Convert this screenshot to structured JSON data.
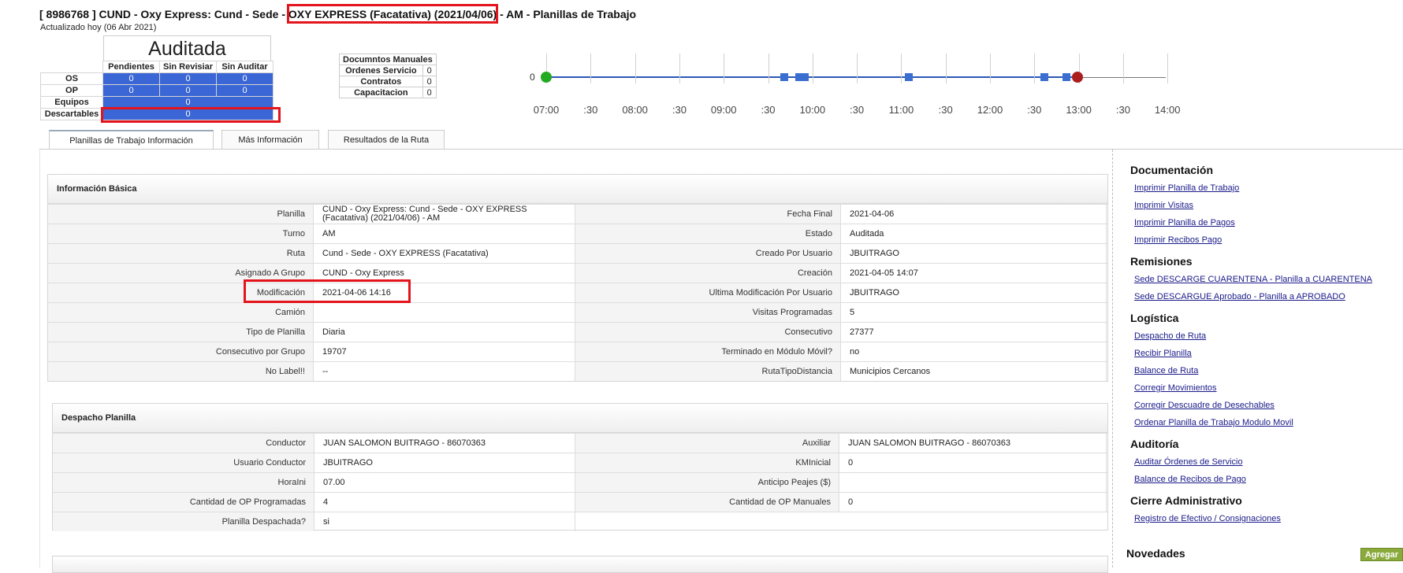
{
  "header": {
    "title": "[ 8986768 ] CUND - Oxy Express: Cund - Sede - OXY EXPRESS (Facatativa) (2021/04/06) - AM - Planillas de Trabajo",
    "updated": "Actualizado hoy (06 Abr 2021)"
  },
  "status": {
    "title": "Auditada",
    "columns": [
      "Pendientes",
      "Sin Revisiar",
      "Sin Auditar"
    ],
    "rows": [
      {
        "label": "OS",
        "values": [
          "0",
          "0",
          "0"
        ]
      },
      {
        "label": "OP",
        "values": [
          "0",
          "0",
          "0"
        ]
      },
      {
        "label": "Equipos",
        "value": "0"
      },
      {
        "label": "Descartables",
        "value": "0"
      }
    ]
  },
  "doc_manual": {
    "title": "Documntos Manuales",
    "rows": [
      {
        "label": "Ordenes Servicio",
        "value": "0"
      },
      {
        "label": "Contratos",
        "value": "0"
      },
      {
        "label": "Capacitacion",
        "value": "0"
      }
    ]
  },
  "timeline": {
    "zero_label": "0",
    "labels": [
      "07:00",
      ":30",
      "08:00",
      ":30",
      "09:00",
      ":30",
      "10:00",
      ":30",
      "11:00",
      ":30",
      "12:00",
      ":30",
      "13:00",
      ":30",
      "14:00"
    ],
    "start_color": "#22aa22",
    "end_color": "#aa1e1e",
    "marker_color": "#3b6ed1"
  },
  "tabs": [
    "Planillas de Trabajo Información",
    "Más Información",
    "Resultados de la Ruta"
  ],
  "info_basica": {
    "title": "Información Básica",
    "left": [
      {
        "label": "Planilla",
        "value": "CUND - Oxy Express: Cund - Sede - OXY EXPRESS (Facatativa) (2021/04/06) - AM"
      },
      {
        "label": "Turno",
        "value": "AM"
      },
      {
        "label": "Ruta",
        "value": "Cund - Sede - OXY EXPRESS (Facatativa)"
      },
      {
        "label": "Asignado A Grupo",
        "value": "CUND - Oxy Express"
      },
      {
        "label": "Modificación",
        "value": "2021-04-06 14:16"
      },
      {
        "label": "Camión",
        "value": ""
      },
      {
        "label": "Tipo de Planilla",
        "value": "Diaria"
      },
      {
        "label": "Consecutivo por Grupo",
        "value": "19707"
      },
      {
        "label": "No Label!!",
        "value": "--"
      }
    ],
    "right": [
      {
        "label": "Fecha Final",
        "value": "2021-04-06"
      },
      {
        "label": "Estado",
        "value": "Auditada"
      },
      {
        "label": "Creado Por Usuario",
        "value": "JBUITRAGO"
      },
      {
        "label": "Creación",
        "value": "2021-04-05 14:07"
      },
      {
        "label": "Ultima Modificación Por Usuario",
        "value": "JBUITRAGO"
      },
      {
        "label": "Visitas Programadas",
        "value": "5"
      },
      {
        "label": "Consecutivo",
        "value": "27377"
      },
      {
        "label": "Terminado en Módulo Móvil?",
        "value": "no"
      },
      {
        "label": "RutaTipoDistancia",
        "value": "Municipios Cercanos"
      }
    ]
  },
  "despacho": {
    "title": "Despacho Planilla",
    "left": [
      {
        "label": "Conductor",
        "value": "JUAN SALOMON BUITRAGO - 86070363"
      },
      {
        "label": "Usuario Conductor",
        "value": "JBUITRAGO"
      },
      {
        "label": "HoraIni",
        "value": "07.00"
      },
      {
        "label": "Cantidad de OP Programadas",
        "value": "4"
      },
      {
        "label": "Planilla Despachada?",
        "value": "si"
      }
    ],
    "right": [
      {
        "label": "Auxiliar",
        "value": "JUAN SALOMON BUITRAGO - 86070363"
      },
      {
        "label": "KMInicial",
        "value": "0"
      },
      {
        "label": "Anticipo Peajes ($)",
        "value": ""
      },
      {
        "label": "Cantidad de OP Manuales",
        "value": "0"
      }
    ]
  },
  "sidebar": {
    "sections": [
      {
        "title": "Documentación",
        "links": [
          "Imprimir Planilla de Trabajo",
          "Imprimir Visitas",
          "Imprimir Planilla de Pagos",
          "Imprimir Recibos Pago"
        ]
      },
      {
        "title": "Remisiones",
        "links": [
          "Sede DESCARGE CUARENTENA - Planilla a CUARENTENA",
          "Sede DESCARGUE Aprobado - Planilla a APROBADO"
        ]
      },
      {
        "title": "Logística",
        "links": [
          "Despacho de Ruta",
          "Recibir Planilla",
          "Balance de Ruta",
          "Corregir Movimientos",
          "Corregir Descuadre de Desechables",
          "Ordenar Planilla de Trabajo Modulo Movil"
        ]
      },
      {
        "title": "Auditoría",
        "links": [
          "Auditar Órdenes de Servicio",
          "Balance de Recibos de Pago"
        ]
      },
      {
        "title": "Cierre Administrativo",
        "links": [
          "Registro de Efectivo / Consignaciones"
        ]
      }
    ],
    "novedades": "Novedades",
    "agregar": "Agregar"
  }
}
